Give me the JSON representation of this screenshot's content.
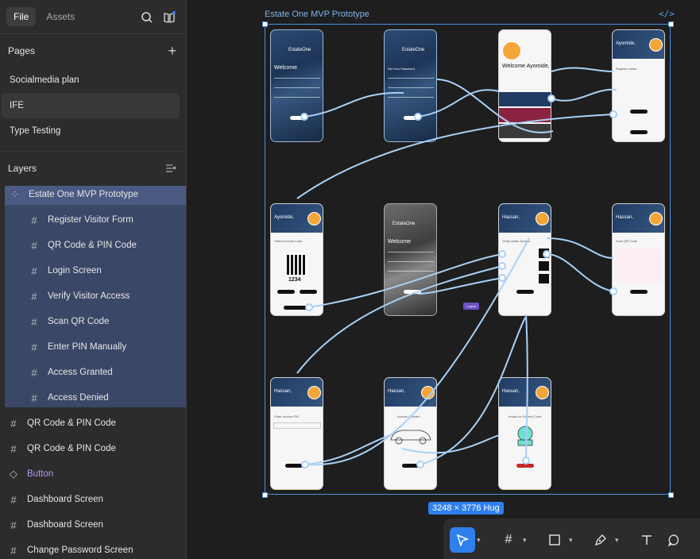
{
  "left_panel": {
    "tabs": [
      {
        "label": "File",
        "active": true
      },
      {
        "label": "Assets",
        "active": false
      }
    ],
    "pages_heading": "Pages",
    "pages": [
      {
        "label": "Socialmedia plan",
        "selected": false
      },
      {
        "label": "IFE",
        "selected": true
      },
      {
        "label": "Type Testing",
        "selected": false
      }
    ],
    "layers_heading": "Layers",
    "layers": [
      {
        "label": "Estate One MVP Prototype",
        "depth": 0,
        "icon": "section-icon"
      },
      {
        "label": "Register Visitor Form",
        "depth": 1,
        "icon": "frame-icon"
      },
      {
        "label": "QR Code & PIN Code",
        "depth": 1,
        "icon": "frame-icon"
      },
      {
        "label": "Login Screen",
        "depth": 1,
        "icon": "frame-icon"
      },
      {
        "label": "Verify Visitor Access",
        "depth": 1,
        "icon": "frame-icon"
      },
      {
        "label": "Scan QR Code",
        "depth": 1,
        "icon": "frame-icon"
      },
      {
        "label": "Enter PIN Manually",
        "depth": 1,
        "icon": "frame-icon"
      },
      {
        "label": "Access Granted",
        "depth": 1,
        "icon": "frame-icon"
      },
      {
        "label": "Access Denied",
        "depth": 1,
        "icon": "frame-icon"
      },
      {
        "label": "QR Code & PIN Code",
        "depth": 0,
        "icon": "frame-icon"
      },
      {
        "label": "QR Code & PIN Code",
        "depth": 0,
        "icon": "frame-icon"
      },
      {
        "label": "Button",
        "depth": 0,
        "icon": "component-icon"
      },
      {
        "label": "Dashboard Screen",
        "depth": 0,
        "icon": "frame-icon"
      },
      {
        "label": "Dashboard Screen",
        "depth": 0,
        "icon": "frame-icon"
      },
      {
        "label": "Change Password Screen",
        "depth": 0,
        "icon": "frame-icon"
      }
    ]
  },
  "canvas": {
    "frame_title": "Estate One MVP Prototype",
    "frame_size": "3248 × 3776 Hug",
    "code_icon_label": "</>",
    "phones": [
      {
        "title": "EstateOne",
        "heading": "Welcome",
        "style": "dark"
      },
      {
        "title": "EstateOne",
        "heading": "Set Your Password",
        "style": "dark"
      },
      {
        "title": "",
        "heading": "Welcome Ayomide,",
        "style": "light"
      },
      {
        "title": "Ayomide,",
        "heading": "Register visitor",
        "style": "light"
      },
      {
        "title": "Ayomide,",
        "heading": "Visitor Access Code",
        "style": "light",
        "pin": "1234"
      },
      {
        "title": "EstateOne",
        "heading": "Welcome",
        "style": "gray"
      },
      {
        "title": "Hassan,",
        "heading": "Verify visitor Access",
        "style": "light"
      },
      {
        "title": "Hassan,",
        "heading": "Scan QR Code",
        "style": "light"
      },
      {
        "title": "Hassan,",
        "heading": "Enter Access PIN",
        "style": "light"
      },
      {
        "title": "Hassan,",
        "heading": "Access Granted",
        "style": "light"
      },
      {
        "title": "Hassan,",
        "heading": "Invalid or Expired Code",
        "style": "light"
      }
    ],
    "logout_label": "Logout"
  },
  "toolbar": {
    "tools": [
      "move-tool",
      "frame-tool",
      "rectangle-tool",
      "pen-tool",
      "text-tool",
      "comment-tool"
    ]
  },
  "colors": {
    "accent": "#2f80ed",
    "panel": "#2c2c2c",
    "canvas": "#1e1e1e",
    "selection": "#4a90e2",
    "layer_highlight": "#3a4767"
  }
}
